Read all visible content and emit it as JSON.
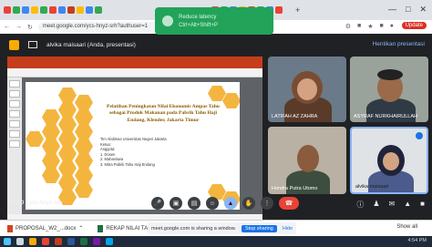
{
  "browser": {
    "url": "meet.google.com/ycs-hnyz-srh?authuser=1",
    "update_label": "Update",
    "new_tab": "+"
  },
  "toast": {
    "line1": "Reduce latency",
    "line2": "Ctrl+Alt+Shift+P"
  },
  "meet": {
    "presenter_title": "alvika maisaari (Anda, presentasi)",
    "right_link": "Hentikan presentasi",
    "meeting_time": "16.50",
    "meeting_code": "ycs-hnyz-srh"
  },
  "slide": {
    "title": "Pelatihan Peningkatan Nilai Ekonomis Ampas Tahu sebagai Produk Makanan pada Pabrik Tahu Haji Endang, Klender, Jakarta Timur",
    "body": [
      "Tim Abdimas Universitas Negeri Jakarta",
      "Ketua:",
      "Anggota:",
      "1. Dosen",
      "2. Mahasiswa",
      "3. Mitra Pabrik Tahu Haji Endang"
    ]
  },
  "participants": [
    {
      "name": "LATIFAH AZ ZAHRA"
    },
    {
      "name": "ASYRAF NURKHAIRULLAH"
    },
    {
      "name": "Hondra Putra Utomo"
    },
    {
      "name": "alvika maisaari"
    }
  ],
  "downloads": [
    {
      "name": "PROPOSAL_W2_...docx"
    },
    {
      "name": "REKAP NILAI TA_....xlsx"
    }
  ],
  "share_bar": {
    "text": "meet.google.com is sharing a window.",
    "stop_label": "Stop sharing",
    "hide_label": "Hide"
  },
  "show_all": "Show all",
  "taskbar_time": "4:54 PM",
  "colors": {
    "meet_bg": "#202124",
    "accent_blue": "#8ab4f8",
    "end_call": "#ea4335",
    "slide_hex": "#f4b53f"
  }
}
